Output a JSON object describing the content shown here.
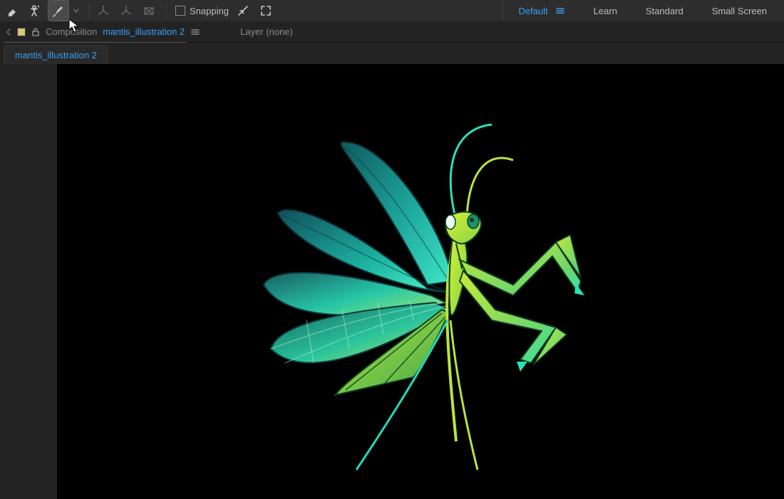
{
  "toolbar": {
    "snapping_label": "Snapping"
  },
  "workspaces": {
    "default": "Default",
    "learn": "Learn",
    "standard": "Standard",
    "small": "Small Screen"
  },
  "crumb": {
    "composition_label": "Composition",
    "composition_name": "mantis_illustration 2",
    "layer_label": "Layer (none)"
  },
  "tab": {
    "name": "mantis_illustration 2"
  }
}
